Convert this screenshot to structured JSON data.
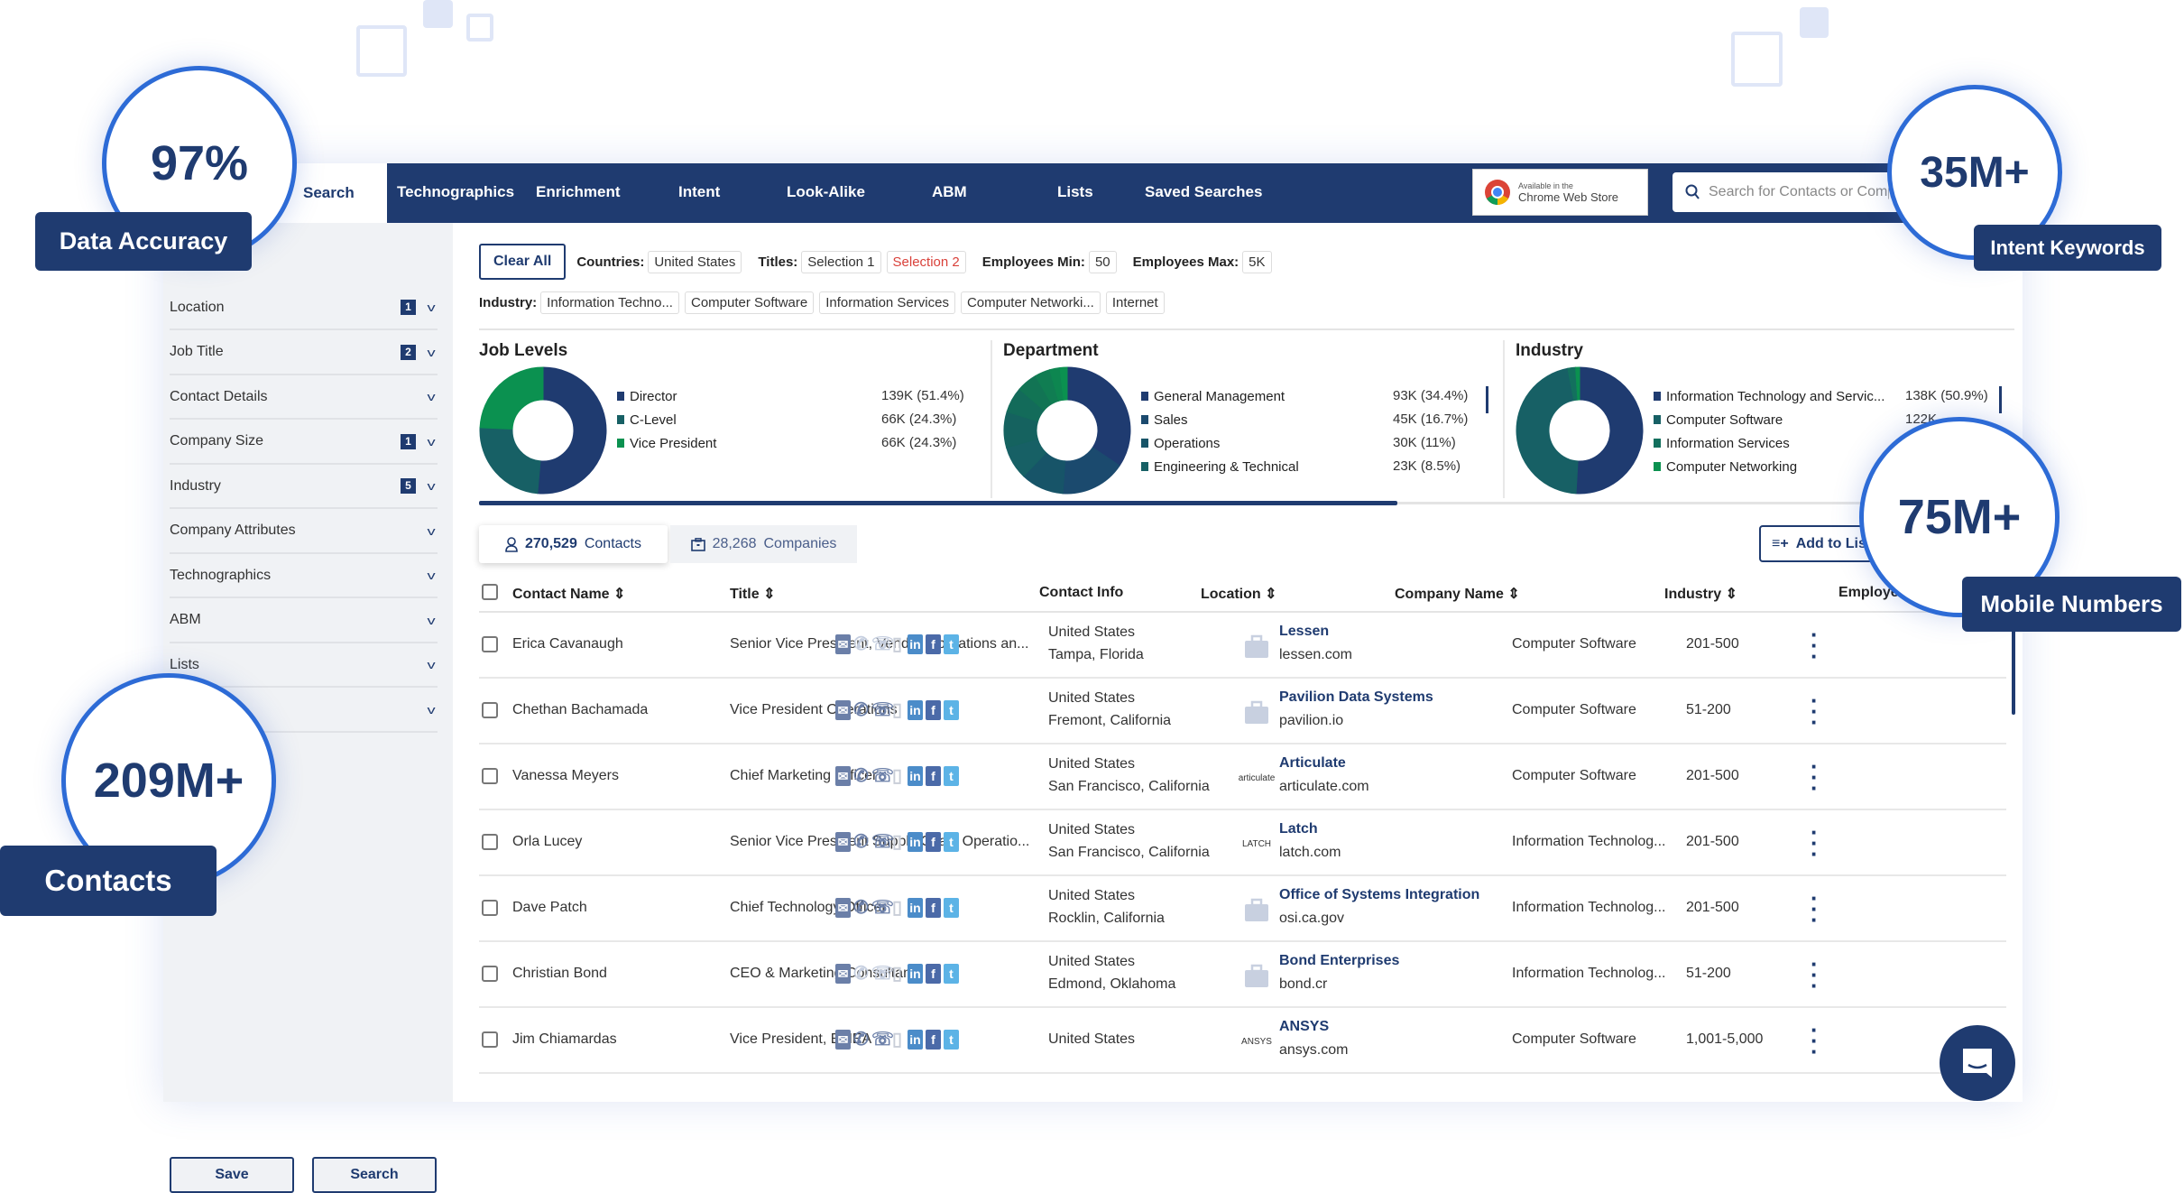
{
  "colors": {
    "brand": "#1f3b70",
    "accent_ring": "#2d6bd6",
    "teal": "#176065",
    "green": "#0b9150",
    "selection_red": "#d9413a",
    "link": "#1f3b70"
  },
  "nav": {
    "active_tab": "Search",
    "items": [
      "Technographics",
      "Enrichment",
      "Intent",
      "Look-Alike",
      "ABM",
      "Lists",
      "Saved Searches"
    ],
    "chrome_store": {
      "line1": "Available in the",
      "line2": "Chrome Web Store"
    },
    "search_placeholder": "Search for Contacts or Companies"
  },
  "sidebar": {
    "items": [
      {
        "label": "Location",
        "count": "1"
      },
      {
        "label": "Job Title",
        "count": "2"
      },
      {
        "label": "Contact Details",
        "count": null
      },
      {
        "label": "Company Size",
        "count": "1"
      },
      {
        "label": "Industry",
        "count": "5"
      },
      {
        "label": "Company Attributes",
        "count": null
      },
      {
        "label": "Technographics",
        "count": null
      },
      {
        "label": "ABM",
        "count": null
      },
      {
        "label": "Lists",
        "count": null
      },
      {
        "label": "",
        "count": null
      }
    ],
    "save_label": "Save",
    "search_label": "Search"
  },
  "filters": {
    "clear_all": "Clear All",
    "countries_label": "Countries:",
    "countries": [
      "United States"
    ],
    "titles_label": "Titles:",
    "titles": [
      "Selection 1",
      "Selection 2"
    ],
    "emp_min_label": "Employees Min:",
    "emp_min": "50",
    "emp_max_label": "Employees Max:",
    "emp_max": "5K",
    "industry_label": "Industry:",
    "industries": [
      "Information Techno...",
      "Computer Software",
      "Information Services",
      "Computer Networki...",
      "Internet"
    ]
  },
  "chart_data": [
    {
      "type": "pie",
      "title": "Job Levels",
      "donut": true,
      "slices": [
        {
          "label": "Director",
          "value": "139K (51.4%)",
          "pct": 51.4,
          "color": "#1f3b70"
        },
        {
          "label": "C-Level",
          "value": "66K (24.3%)",
          "pct": 24.3,
          "color": "#176065"
        },
        {
          "label": "Vice President",
          "value": "66K (24.3%)",
          "pct": 24.3,
          "color": "#0b9150"
        }
      ]
    },
    {
      "type": "pie",
      "title": "Department",
      "donut": true,
      "slices": [
        {
          "label": "General Management",
          "value": "93K (34.4%)",
          "pct": 34.4,
          "color": "#1f3b70"
        },
        {
          "label": "Sales",
          "value": "45K (16.7%)",
          "pct": 16.7,
          "color": "#1b4a6e"
        },
        {
          "label": "Operations",
          "value": "30K (11%)",
          "pct": 11,
          "color": "#175468"
        },
        {
          "label": "Engineering & Technical",
          "value": "23K (8.5%)",
          "pct": 8.5,
          "color": "#176065"
        }
      ]
    },
    {
      "type": "pie",
      "title": "Industry",
      "donut": true,
      "slices": [
        {
          "label": "Information Technology and Servic...",
          "value": "138K (50.9%)",
          "pct": 50.9,
          "color": "#1f3b70"
        },
        {
          "label": "Computer Software",
          "value": "122K",
          "pct": null,
          "color": "#176065"
        },
        {
          "label": "Information Services",
          "value": null,
          "pct": null,
          "color": "#13705e"
        },
        {
          "label": "Computer Networking",
          "value": null,
          "pct": null,
          "color": "#0b9150"
        }
      ]
    }
  ],
  "results": {
    "contacts_count": "270,529",
    "contacts_label": "Contacts",
    "companies_count": "28,268",
    "companies_label": "Companies",
    "add_to_list": "Add to List",
    "columns": [
      "Contact Name",
      "Title",
      "Contact Info",
      "Location",
      "Company Name",
      "Industry",
      "Employees"
    ],
    "rows": [
      {
        "name": "Erica Cavanaugh",
        "title": "Senior Vice President, Vendor Operations an...",
        "phone": false,
        "hq": false,
        "loc1": "United States",
        "loc2": "Tampa, Florida",
        "company": "Lessen",
        "domain": "lessen.com",
        "logo": "briefcase",
        "industry": "Computer Software",
        "employees": "201-500"
      },
      {
        "name": "Chethan Bachamada",
        "title": "Vice President Operations",
        "phone": true,
        "hq": true,
        "loc1": "United States",
        "loc2": "Fremont, California",
        "company": "Pavilion Data Systems",
        "domain": "pavilion.io",
        "logo": "briefcase",
        "industry": "Computer Software",
        "employees": "51-200"
      },
      {
        "name": "Vanessa Meyers",
        "title": "Chief Marketing Officer",
        "phone": true,
        "hq": true,
        "loc1": "United States",
        "loc2": "San Francisco, California",
        "company": "Articulate",
        "domain": "articulate.com",
        "logo": "articulate",
        "industry": "Computer Software",
        "employees": "201-500"
      },
      {
        "name": "Orla Lucey",
        "title": "Senior Vice President Supply Chain Operatio...",
        "phone": true,
        "hq": true,
        "loc1": "United States",
        "loc2": "San Francisco, California",
        "company": "Latch",
        "domain": "latch.com",
        "logo": "LATCH",
        "industry": "Information Technolog...",
        "employees": "201-500"
      },
      {
        "name": "Dave Patch",
        "title": "Chief Technology Officer",
        "phone": true,
        "hq": true,
        "loc1": "United States",
        "loc2": "Rocklin, California",
        "company": "Office of Systems Integration",
        "domain": "osi.ca.gov",
        "logo": "briefcase",
        "industry": "Information Technolog...",
        "employees": "201-500"
      },
      {
        "name": "Christian Bond",
        "title": "CEO & Marketing Consultant",
        "phone": false,
        "hq": false,
        "loc1": "United States",
        "loc2": "Edmond, Oklahoma",
        "company": "Bond Enterprises",
        "domain": "bond.cr",
        "logo": "briefcase",
        "industry": "Information Technolog...",
        "employees": "51-200"
      },
      {
        "name": "Jim Chiamardas",
        "title": "Vice President, EMEA",
        "phone": true,
        "hq": true,
        "loc1": "United States",
        "loc2": "",
        "company": "ANSYS",
        "domain": "ansys.com",
        "logo": "ANSYS",
        "industry": "Computer Software",
        "employees": "1,001-5,000"
      }
    ]
  },
  "callouts": [
    {
      "value": "97%",
      "label": "Data Accuracy"
    },
    {
      "value": "35M+",
      "label": "Intent Keywords"
    },
    {
      "value": "75M+",
      "label": "Mobile Numbers"
    },
    {
      "value": "209M+",
      "label": "Contacts"
    }
  ]
}
